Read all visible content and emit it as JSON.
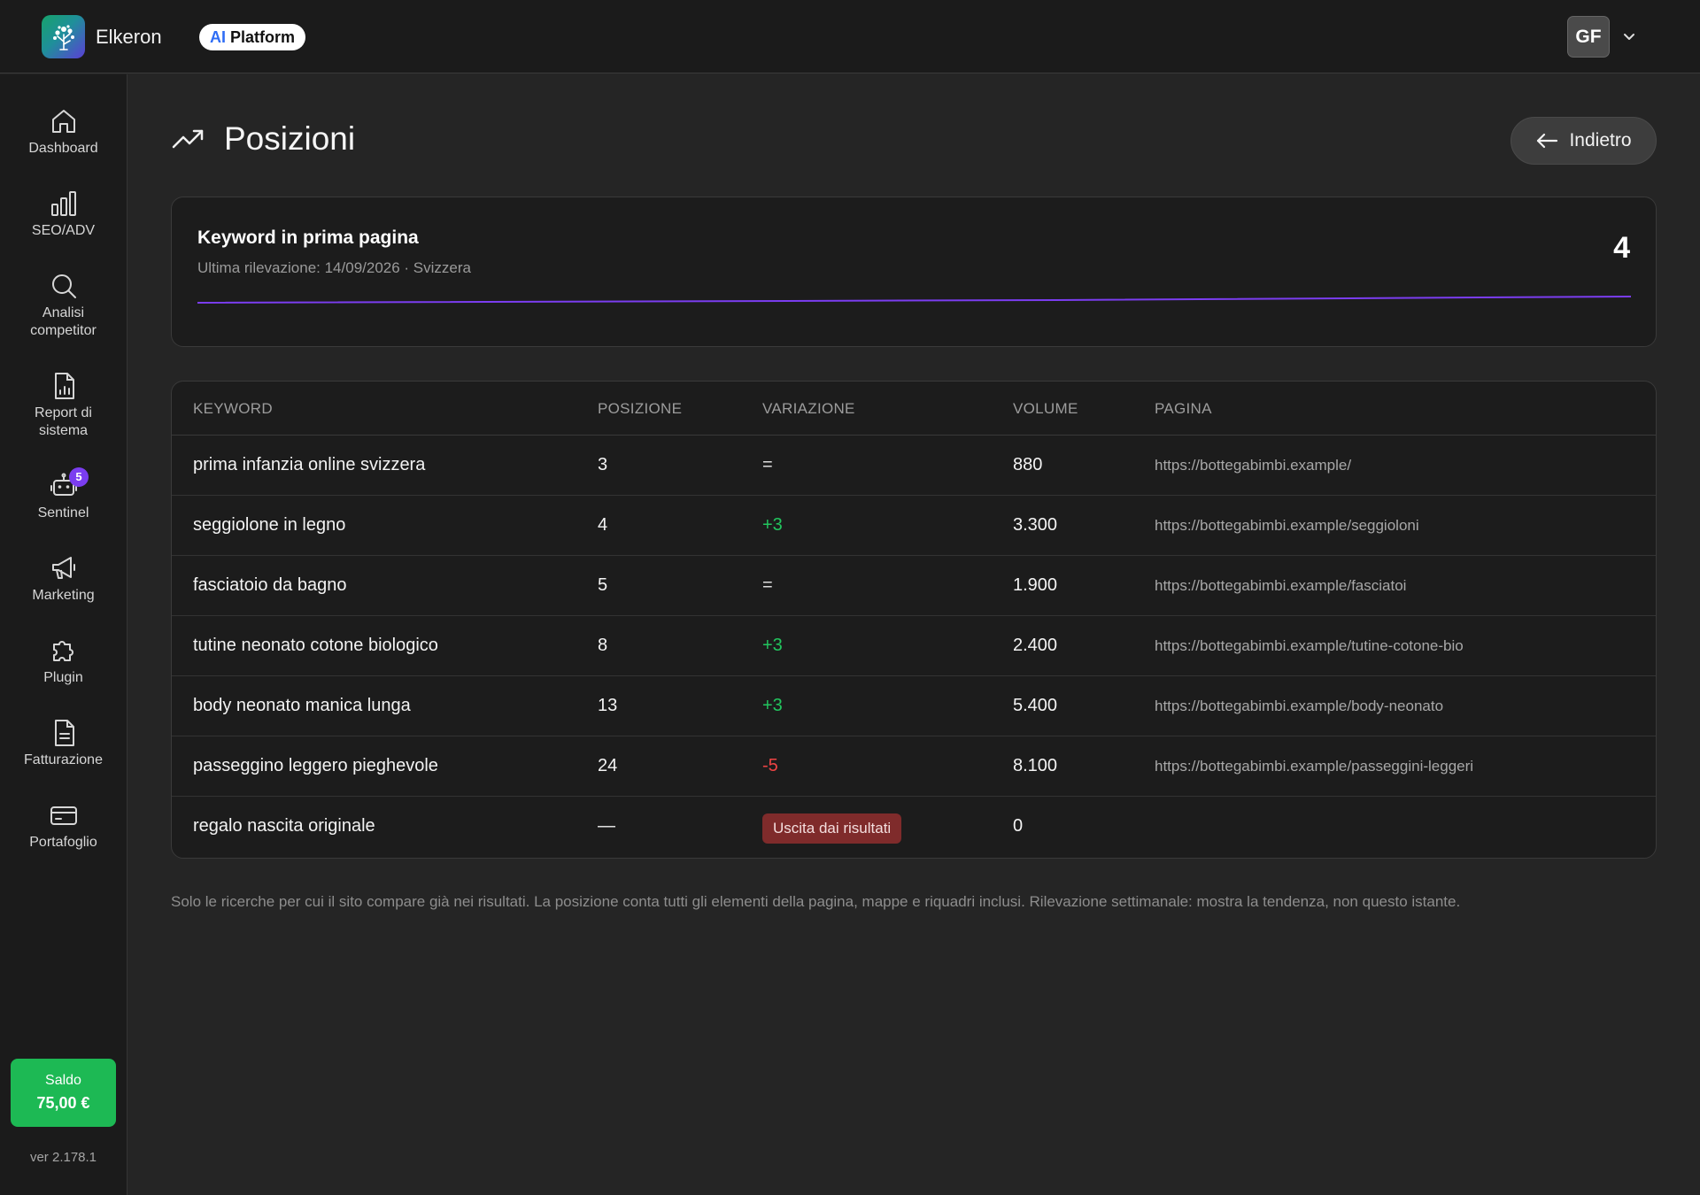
{
  "header": {
    "app_name": "Elkeron",
    "pill_ai": "AI",
    "pill_platform": "Platform",
    "avatar_initials": "GF"
  },
  "sidebar": {
    "items": [
      {
        "label": "Dashboard",
        "icon": "home-icon"
      },
      {
        "label": "SEO/ADV",
        "icon": "bar-chart-icon"
      },
      {
        "label": "Analisi competitor",
        "icon": "search-icon"
      },
      {
        "label": "Report di sistema",
        "icon": "report-icon"
      },
      {
        "label": "Sentinel",
        "icon": "robot-icon",
        "badge": "5"
      },
      {
        "label": "Marketing",
        "icon": "megaphone-icon"
      },
      {
        "label": "Plugin",
        "icon": "puzzle-icon"
      },
      {
        "label": "Fatturazione",
        "icon": "invoice-icon"
      },
      {
        "label": "Portafoglio",
        "icon": "wallet-icon"
      }
    ],
    "saldo_label": "Saldo",
    "saldo_value": "75,00 €",
    "version": "ver 2.178.1"
  },
  "page": {
    "title": "Posizioni",
    "back_label": "Indietro"
  },
  "summary": {
    "title": "Keyword in prima pagina",
    "subtitle": "Ultima rilevazione: 14/09/2026 · Svizzera",
    "value": "4"
  },
  "table": {
    "headers": [
      "KEYWORD",
      "POSIZIONE",
      "VARIAZIONE",
      "VOLUME",
      "PAGINA"
    ],
    "rows": [
      {
        "keyword": "prima infanzia online svizzera",
        "position": "3",
        "variation": "=",
        "var_type": "eq",
        "volume": "880",
        "page": "https://bottegabimbi.example/"
      },
      {
        "keyword": "seggiolone in legno",
        "position": "4",
        "variation": "+3",
        "var_type": "up",
        "volume": "3.300",
        "page": "https://bottegabimbi.example/seggioloni"
      },
      {
        "keyword": "fasciatoio da bagno",
        "position": "5",
        "variation": "=",
        "var_type": "eq",
        "volume": "1.900",
        "page": "https://bottegabimbi.example/fasciatoi"
      },
      {
        "keyword": "tutine neonato cotone biologico",
        "position": "8",
        "variation": "+3",
        "var_type": "up",
        "volume": "2.400",
        "page": "https://bottegabimbi.example/tutine-cotone-bio"
      },
      {
        "keyword": "body neonato manica lunga",
        "position": "13",
        "variation": "+3",
        "var_type": "up",
        "volume": "5.400",
        "page": "https://bottegabimbi.example/body-neonato"
      },
      {
        "keyword": "passeggino leggero pieghevole",
        "position": "24",
        "variation": "-5",
        "var_type": "down",
        "volume": "8.100",
        "page": "https://bottegabimbi.example/passeggini-leggeri"
      },
      {
        "keyword": "regalo nascita originale",
        "position": "—",
        "variation": "Uscita dai risultati",
        "var_type": "exit",
        "volume": "0",
        "page": ""
      }
    ]
  },
  "footnote": "Solo le ricerche per cui il sito compare già nei risultati. La posizione conta tutti gli elementi della pagina, mappe e riquadri inclusi. Rilevazione settimanale: mostra la tendenza, non questo istante.",
  "colors": {
    "accent_purple": "#7b3df0",
    "positive": "#22c55e",
    "negative": "#ef4444",
    "saldo_green": "#1db954"
  }
}
